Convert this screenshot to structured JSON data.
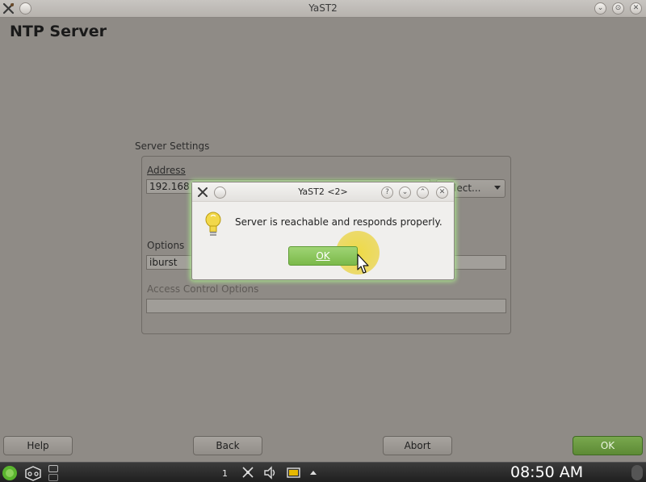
{
  "window": {
    "title": "YaST2",
    "page_title": "NTP Server"
  },
  "form": {
    "section_label": "Server Settings",
    "address_label": "Address",
    "address_value": "192.168",
    "select_label": "Select...",
    "options_label": "Options",
    "options_value": "iburst",
    "access_label": "Access Control Options",
    "access_value": ""
  },
  "buttons": {
    "help": "Help",
    "back": "Back",
    "abort": "Abort",
    "ok": "OK"
  },
  "dialog": {
    "title": "YaST2 <2>",
    "message": "Server is reachable and responds properly.",
    "ok_label": "OK",
    "icon": "lightbulb-icon"
  },
  "taskbar": {
    "desktop_number": "1",
    "clock": "08:50 AM"
  },
  "colors": {
    "dialog_glow": "#aae68c",
    "ok_green": "#7bb94a",
    "cursor_halo": "#eed628"
  }
}
